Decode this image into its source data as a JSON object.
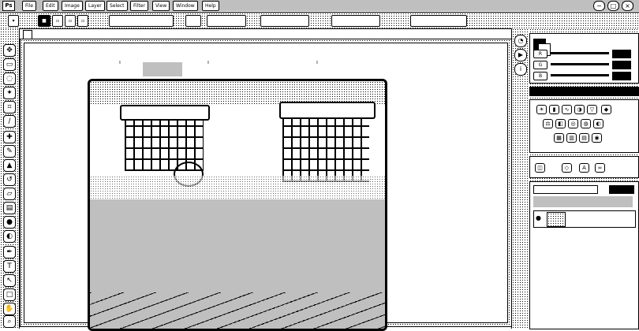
{
  "app": {
    "logo": "Ps"
  },
  "menu": {
    "items": [
      "File",
      "Edit",
      "Image",
      "Layer",
      "Select",
      "Filter",
      "View",
      "Window",
      "Help"
    ]
  },
  "window": {
    "minimize": "−",
    "maximize": "□",
    "close": "×"
  },
  "options": {
    "zoom_value": "",
    "buttons": [
      "",
      "",
      "",
      "",
      "",
      ""
    ]
  },
  "document": {
    "tab_label": ""
  },
  "tools": {
    "icons": [
      "move-icon",
      "marquee-icon",
      "lasso-icon",
      "magic-wand-icon",
      "crop-icon",
      "eyedropper-icon",
      "healing-icon",
      "brush-icon",
      "stamp-icon",
      "history-brush-icon",
      "eraser-icon",
      "gradient-icon",
      "blur-icon",
      "dodge-icon",
      "pen-icon",
      "type-icon",
      "path-select-icon",
      "shape-icon",
      "hand-icon",
      "zoom-icon"
    ]
  },
  "panels": {
    "color": {
      "slider_labels": [
        "R",
        "G",
        "B"
      ],
      "values": [
        "",
        "",
        ""
      ]
    },
    "layers": {
      "layer_name": ""
    }
  },
  "colors": {
    "ink": "#000000",
    "paper": "#ffffff"
  }
}
